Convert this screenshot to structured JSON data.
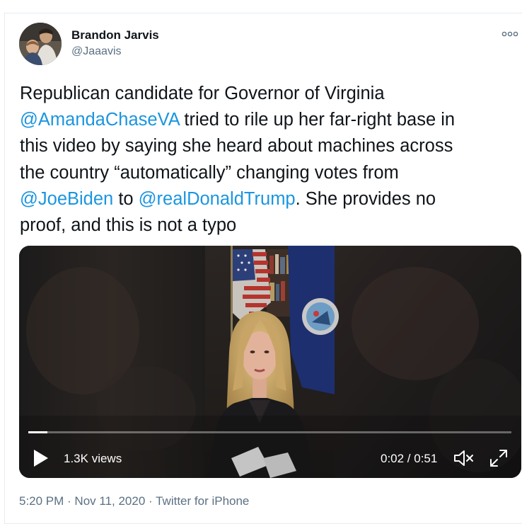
{
  "author": {
    "name": "Brandon Jarvis",
    "handle": "@Jaaavis"
  },
  "more_icon": "more-horizontal-icon",
  "tweet": {
    "lines": [
      [
        {
          "text": "Republican candidate for Governor of Virginia",
          "mention": false
        }
      ],
      [
        {
          "text": "@AmandaChaseVA",
          "mention": true
        },
        {
          "text": " tried to rile up her far-right base in",
          "mention": false
        }
      ],
      [
        {
          "text": "this video by saying she heard about machines across",
          "mention": false
        }
      ],
      [
        {
          "text": "the country “automatically” changing votes from",
          "mention": false
        }
      ],
      [
        {
          "text": "@JoeBiden",
          "mention": true
        },
        {
          "text": " to ",
          "mention": false
        },
        {
          "text": "@realDonaldTrump",
          "mention": true
        },
        {
          "text": ". She provides no",
          "mention": false
        }
      ],
      [
        {
          "text": "proof, and this is not a typo",
          "mention": false
        }
      ]
    ]
  },
  "video": {
    "views": "1.3K views",
    "time": "0:02 / 0:51",
    "progress": 0.039,
    "icons": {
      "play": "play-icon",
      "mute": "volume-muted-icon",
      "fullscreen": "fullscreen-icon"
    }
  },
  "meta": {
    "time": "5:20 PM",
    "separator1": " · ",
    "date": "Nov 11, 2020",
    "separator2": " · ",
    "source": "Twitter for iPhone"
  },
  "colors": {
    "mention": "#1b95e0",
    "secondary_text": "#5b7083"
  }
}
